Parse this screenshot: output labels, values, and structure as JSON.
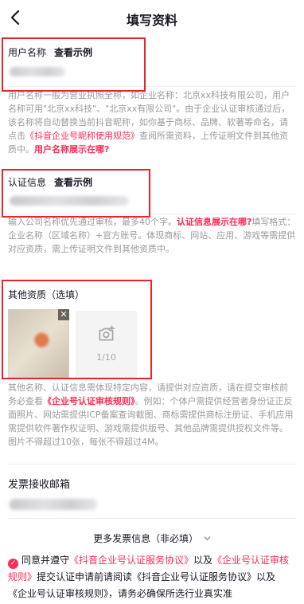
{
  "nav": {
    "title": "填写资料"
  },
  "username": {
    "label": "用户名称",
    "example": "查看示例",
    "value": ""
  },
  "username_desc": {
    "text1": "用户名称一般为营业执照全称，如企业名称：北京xx科技有限公司，用户名称可用\"北京xx科技\"、\"北京xx有限公司\"。由于企业认证审核通过后，该名称将自动替换当前抖音昵称，如你基于商标、品牌、软著等命名，请点击",
    "link1": "《抖音企业号昵称使用规范》",
    "text2": "查阅所需资料，上传证明文件到其他资质中。",
    "link2": "用户名称展示在哪?"
  },
  "cert": {
    "label": "认证信息",
    "example": "查看示例",
    "value": ""
  },
  "cert_desc": {
    "text1": "输入公司名称优先通过审核，最多40个字。",
    "link1": "认证信息展示在哪?",
    "text2": "填写格式：企业名称（区域名称）+官方账号。体现商标、网站、应用、游戏等需提供对应资质，需上传证明文件到其他资质中。"
  },
  "other": {
    "label": "其他资质（选填）",
    "upload_count": "1/10"
  },
  "other_desc": {
    "text1": "其他名称、认证信息需体现特定内容，请提供对应资质，请在提交审核前务必查看",
    "link1": "《企业号认证审核规则》",
    "text2": "。例如：个体户需提供经营者身份证正反面照片、网站需提供ICP备案查询截图、商标需提供商标注册证、手机应用需提供软件著作权证明、游戏需提供版号、其他品牌需提供授权文件等。图片不得超过10张，每张不得超过4M。"
  },
  "invoice": {
    "email_label": "发票接收邮箱",
    "email_value": "",
    "more": "更多发票信息（非必填）"
  },
  "agreement": {
    "text1": "同意并遵守",
    "link1": "《抖音企业号认证服务协议》",
    "text2": "以及",
    "link2": "《企业号认证审核规则》",
    "text3": "提交认证申请前请阅读《抖音企业号认证服务协议》以及《企业号认证审核规则》，请务必确保所选行业真实准"
  },
  "colors": {
    "accent": "#fe2c55",
    "highlight_box": "#e8232a"
  },
  "icons": [
    "back-arrow-icon",
    "close-icon",
    "add-photo-icon",
    "chevron-down-icon",
    "check-icon"
  ]
}
